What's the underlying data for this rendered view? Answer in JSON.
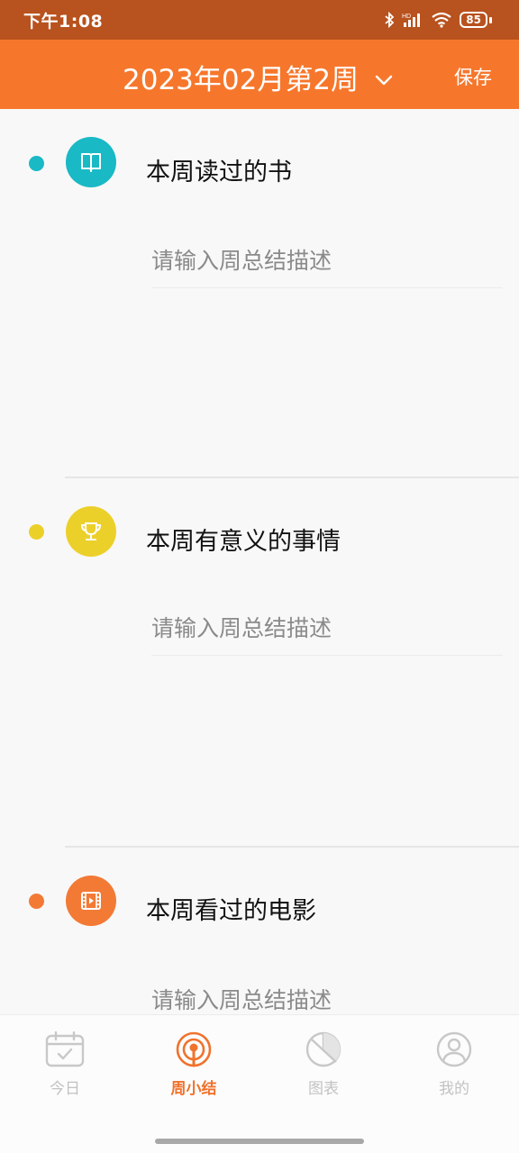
{
  "status_bar": {
    "time": "下午1:08",
    "battery": "85",
    "icons": [
      "bluetooth-icon",
      "hd-signal-icon",
      "wifi-icon",
      "battery-icon"
    ]
  },
  "header": {
    "title": "2023年02月第2周",
    "dropdown_icon": "chevron-down-icon",
    "save_label": "保存",
    "background": "#f6772c"
  },
  "sections": [
    {
      "title": "本周读过的书",
      "placeholder": "请输入周总结描述",
      "icon": "book-icon",
      "color": "#19b9c5"
    },
    {
      "title": "本周有意义的事情",
      "placeholder": "请输入周总结描述",
      "icon": "trophy-icon",
      "color": "#ecd02a"
    },
    {
      "title": "本周看过的电影",
      "placeholder": "请输入周总结描述",
      "icon": "film-icon",
      "color": "#f37a35"
    }
  ],
  "nav": {
    "items": [
      {
        "label": "今日",
        "icon": "calendar-check-icon"
      },
      {
        "label": "周小结",
        "icon": "broadcast-icon",
        "active": true
      },
      {
        "label": "图表",
        "icon": "pie-chart-icon"
      },
      {
        "label": "我的",
        "icon": "user-icon"
      }
    ],
    "active_color": "#f0722c",
    "inactive_color": "#c2c2c2"
  }
}
